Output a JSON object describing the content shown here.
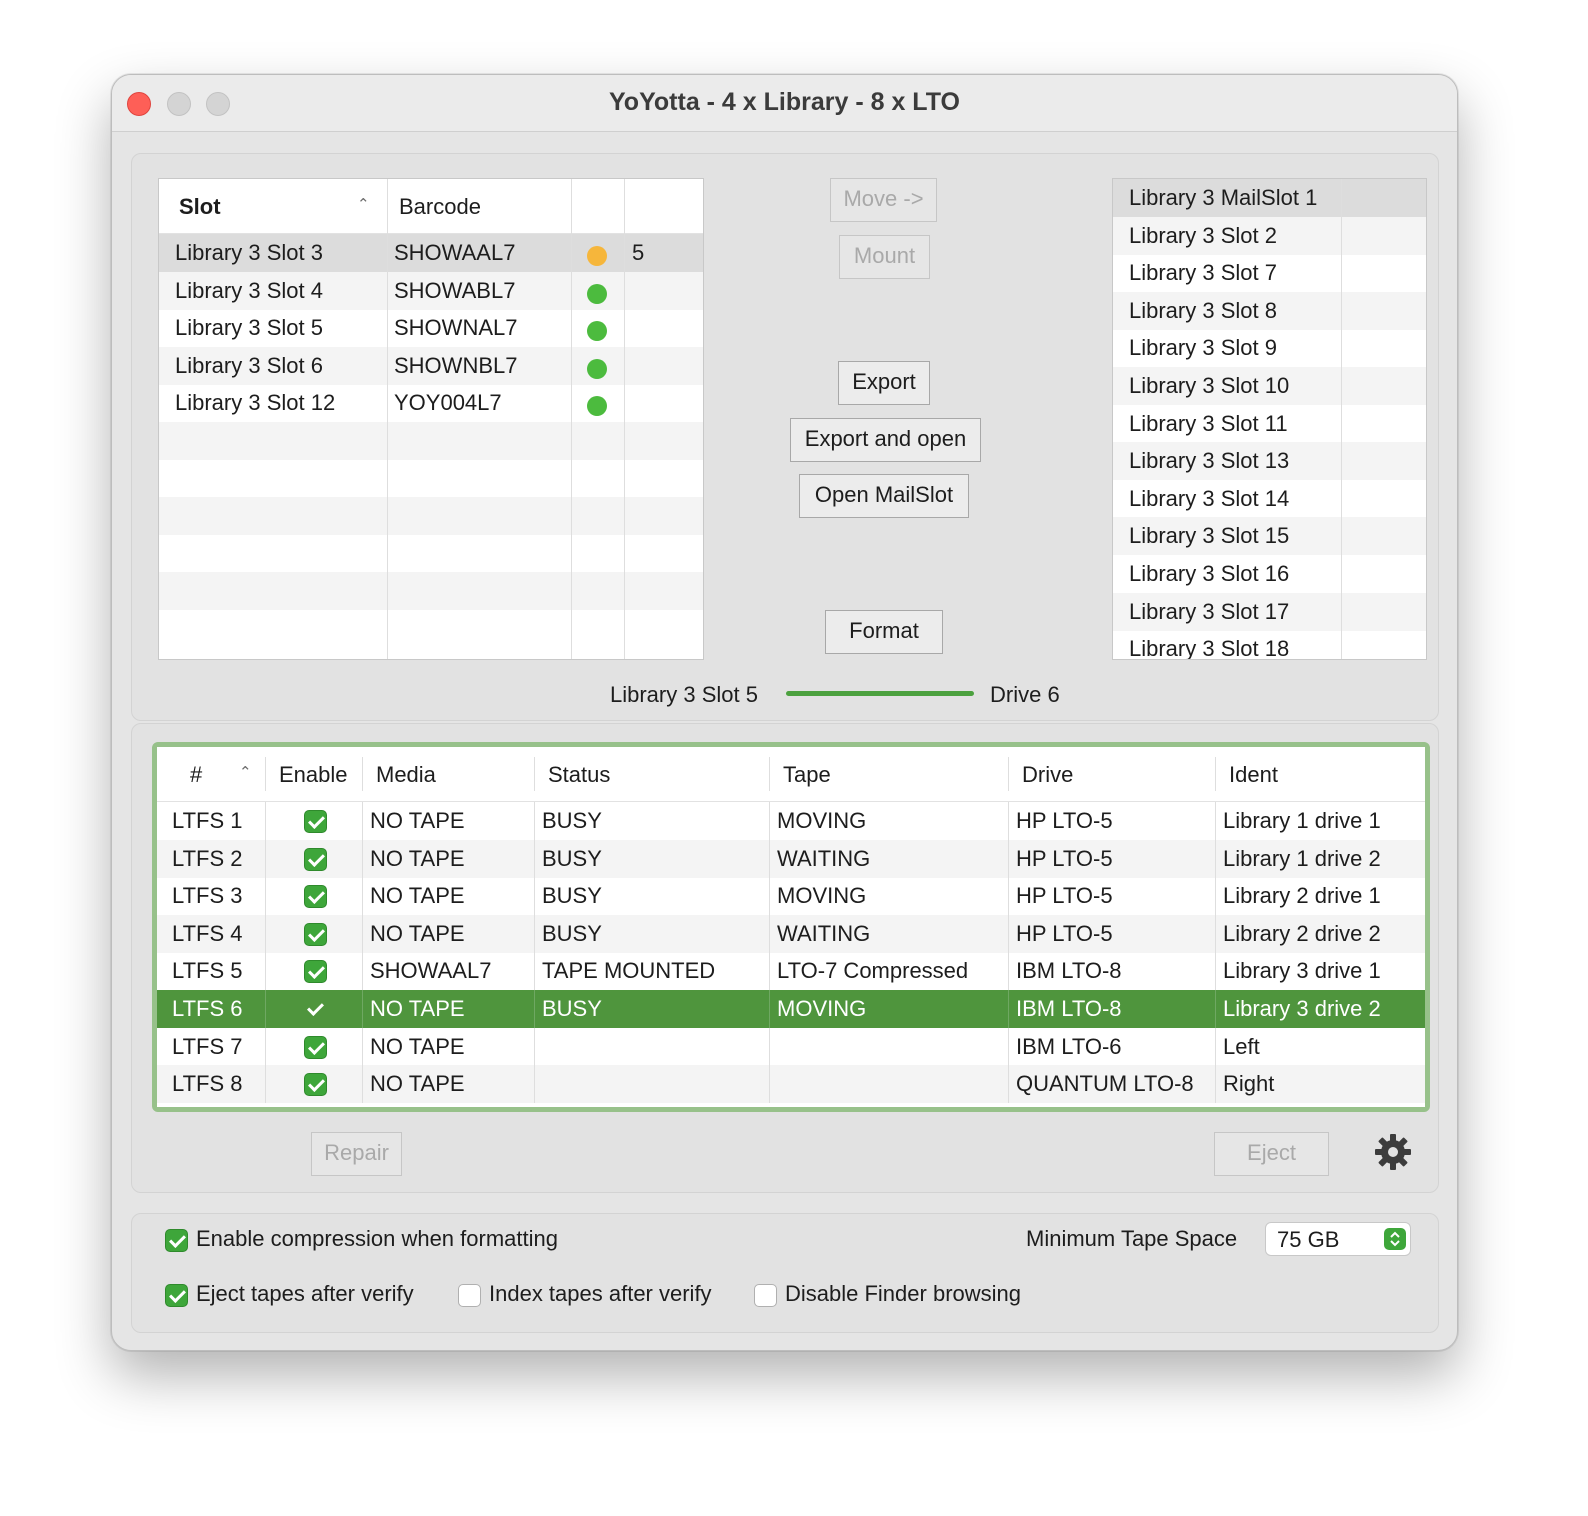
{
  "window": {
    "title": "YoYotta - 4 x Library - 8 x LTO"
  },
  "slots_table": {
    "headers": [
      "Slot",
      "Barcode",
      "",
      ""
    ],
    "rows": [
      {
        "slot": "Library 3 Slot 3",
        "barcode": "SHOWAAL7",
        "status_color": "orange",
        "drive": "5"
      },
      {
        "slot": "Library 3 Slot 4",
        "barcode": "SHOWABL7",
        "status_color": "green",
        "drive": ""
      },
      {
        "slot": "Library 3 Slot 5",
        "barcode": "SHOWNAL7",
        "status_color": "green",
        "drive": ""
      },
      {
        "slot": "Library 3 Slot 6",
        "barcode": "SHOWNBL7",
        "status_color": "green",
        "drive": ""
      },
      {
        "slot": "Library 3 Slot 12",
        "barcode": "YOY004L7",
        "status_color": "green",
        "drive": ""
      }
    ]
  },
  "actions": {
    "move": "Move ->",
    "mount": "Mount",
    "export": "Export",
    "export_open": "Export and open",
    "open_mailslot": "Open MailSlot",
    "format": "Format"
  },
  "destination_list": [
    "Library 3 MailSlot 1",
    "Library 3 Slot 2",
    "Library 3 Slot 7",
    "Library 3 Slot 8",
    "Library 3 Slot 9",
    "Library 3 Slot 10",
    "Library 3 Slot 11",
    "Library 3 Slot 13",
    "Library 3 Slot 14",
    "Library 3 Slot 15",
    "Library 3 Slot 16",
    "Library 3 Slot 17",
    "Library 3 Slot 18"
  ],
  "transfer": {
    "from": "Library 3 Slot 5",
    "to": "Drive 6",
    "color": "#4ca13f"
  },
  "drives_table": {
    "headers": [
      "#",
      "Enable",
      "Media",
      "Status",
      "Tape",
      "Drive",
      "Ident"
    ],
    "rows": [
      {
        "id": "LTFS 1",
        "enabled": true,
        "media": "NO TAPE",
        "status": "BUSY",
        "tape": "MOVING",
        "drive": "HP LTO-5",
        "ident": "Library 1 drive 1"
      },
      {
        "id": "LTFS 2",
        "enabled": true,
        "media": "NO TAPE",
        "status": "BUSY",
        "tape": "WAITING",
        "drive": "HP LTO-5",
        "ident": "Library 1 drive 2"
      },
      {
        "id": "LTFS 3",
        "enabled": true,
        "media": "NO TAPE",
        "status": "BUSY",
        "tape": "MOVING",
        "drive": "HP LTO-5",
        "ident": "Library 2 drive 1"
      },
      {
        "id": "LTFS 4",
        "enabled": true,
        "media": "NO TAPE",
        "status": "BUSY",
        "tape": "WAITING",
        "drive": "HP LTO-5",
        "ident": "Library 2 drive 2"
      },
      {
        "id": "LTFS 5",
        "enabled": true,
        "media": "SHOWAAL7",
        "status": "TAPE MOUNTED",
        "tape": "LTO-7 Compressed",
        "drive": "IBM LTO-8",
        "ident": "Library 3 drive 1"
      },
      {
        "id": "LTFS 6",
        "enabled": true,
        "media": "NO TAPE",
        "status": "BUSY",
        "tape": "MOVING",
        "drive": "IBM LTO-8",
        "ident": "Library 3 drive 2"
      },
      {
        "id": "LTFS 7",
        "enabled": true,
        "media": "NO TAPE",
        "status": "",
        "tape": "",
        "drive": "IBM LTO-6",
        "ident": "Left"
      },
      {
        "id": "LTFS 8",
        "enabled": true,
        "media": "NO TAPE",
        "status": "",
        "tape": "",
        "drive": "QUANTUM LTO-8",
        "ident": "Right"
      }
    ],
    "selected_color": "#4f953d",
    "focus_color": "#97c18a"
  },
  "drive_actions": {
    "repair": "Repair",
    "eject": "Eject",
    "settings_icon": "gear-icon"
  },
  "options": {
    "enable_compression": {
      "label": "Enable compression when formatting",
      "checked": true
    },
    "eject_after_verify": {
      "label": "Eject tapes after verify",
      "checked": true
    },
    "index_after_verify": {
      "label": "Index tapes after verify",
      "checked": false
    },
    "disable_finder": {
      "label": "Disable Finder browsing",
      "checked": false
    },
    "min_tape_space_label": "Minimum Tape Space",
    "min_tape_space_value": "75 GB"
  }
}
